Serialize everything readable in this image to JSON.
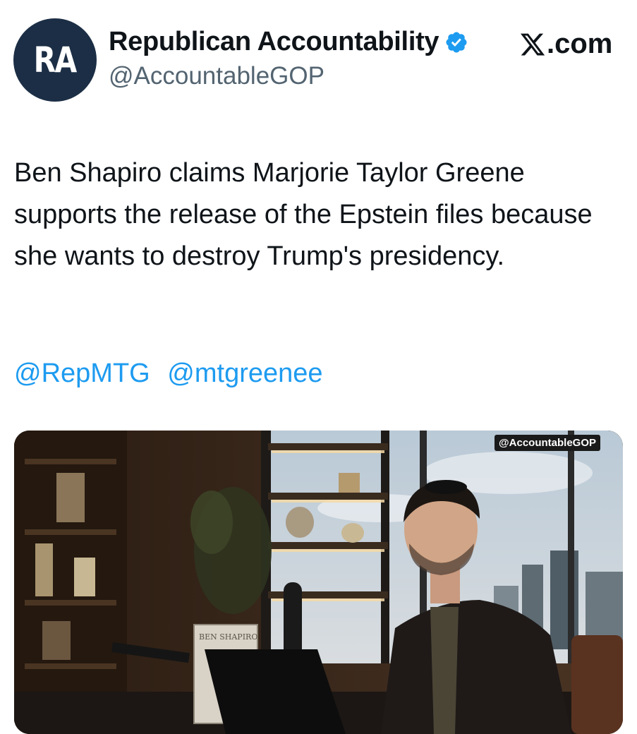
{
  "author": {
    "avatar_text": "RA",
    "display_name": "Republican Accountability",
    "handle": "@AccountableGOP",
    "verified_icon": "verified-badge-icon"
  },
  "site": {
    "label": ".com",
    "logo_icon": "x-logo-icon"
  },
  "tweet": {
    "text": "Ben Shapiro claims Marjorie Taylor Greene supports the release of the Epstein files because she wants to destroy Trump's presidency.",
    "mentions": [
      "@RepMTG",
      "@mtgreenee"
    ]
  },
  "media": {
    "watermark": "@AccountableGOP",
    "book_spine_text": "BEN SHAPIRO"
  },
  "colors": {
    "link": "#1d9bf0",
    "verified": "#1d9bf0",
    "avatar_bg": "#1b2e45",
    "handle": "#536471"
  }
}
